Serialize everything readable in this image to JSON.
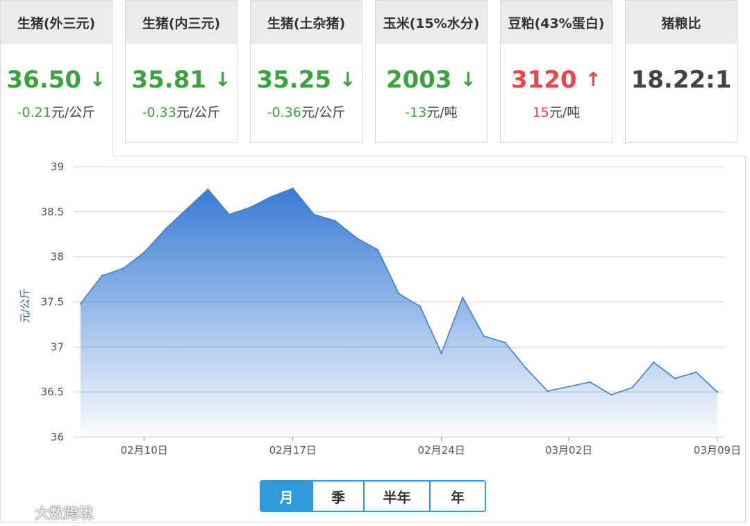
{
  "tabs": [
    {
      "title": "生猪(外三元)",
      "value": "36.50",
      "change": "-0.21",
      "unit": "元/公斤",
      "trend": "down",
      "arrow": "↓"
    },
    {
      "title": "生猪(内三元)",
      "value": "35.81",
      "change": "-0.33",
      "unit": "元/公斤",
      "trend": "down",
      "arrow": "↓"
    },
    {
      "title": "生猪(土杂猪)",
      "value": "35.25",
      "change": "-0.36",
      "unit": "元/公斤",
      "trend": "down",
      "arrow": "↓"
    },
    {
      "title": "玉米(15%水分)",
      "value": "2003",
      "change": "-13",
      "unit": "元/吨",
      "trend": "down",
      "arrow": "↓"
    },
    {
      "title": "豆粕(43%蛋白)",
      "value": "3120",
      "change": "15",
      "unit": "元/吨",
      "trend": "up",
      "arrow": "↑"
    },
    {
      "title": "猪粮比",
      "value": "18.22:1",
      "change": "",
      "unit": "",
      "trend": "neutral",
      "arrow": ""
    }
  ],
  "range_buttons": [
    "月",
    "季",
    "半年",
    "年"
  ],
  "active_range": "月",
  "watermark": "大数跨境",
  "colors": {
    "down": "#3aa340",
    "up": "#e9454d",
    "accent": "#2f9bde",
    "line": "#3f7ecb",
    "area_top": "#2e74d2"
  },
  "chart_data": {
    "type": "area",
    "title": "",
    "xlabel": "",
    "ylabel": "元/公斤",
    "ylim": [
      36,
      39
    ],
    "yticks": [
      "36",
      "36.5",
      "37",
      "37.5",
      "38",
      "38.5",
      "39"
    ],
    "xtick_labels": [
      "02月10日",
      "02月17日",
      "02月24日",
      "03月02日",
      "03月09日"
    ],
    "grid": true,
    "legend": "none",
    "series": [
      {
        "values": [
          {
            "x": "2023-02-07",
            "y": 37.48
          },
          {
            "x": "2023-02-08",
            "y": 37.79
          },
          {
            "x": "2023-02-09",
            "y": 37.87
          },
          {
            "x": "2023-02-10",
            "y": 38.05
          },
          {
            "x": "2023-02-11",
            "y": 38.31
          },
          {
            "x": "2023-02-12",
            "y": 38.53
          },
          {
            "x": "2023-02-13",
            "y": 38.75
          },
          {
            "x": "2023-02-14",
            "y": 38.47
          },
          {
            "x": "2023-02-15",
            "y": 38.55
          },
          {
            "x": "2023-02-16",
            "y": 38.67
          },
          {
            "x": "2023-02-17",
            "y": 38.76
          },
          {
            "x": "2023-02-18",
            "y": 38.47
          },
          {
            "x": "2023-02-19",
            "y": 38.4
          },
          {
            "x": "2023-02-20",
            "y": 38.21
          },
          {
            "x": "2023-02-21",
            "y": 38.08
          },
          {
            "x": "2023-02-22",
            "y": 37.59
          },
          {
            "x": "2023-02-23",
            "y": 37.45
          },
          {
            "x": "2023-02-24",
            "y": 36.93
          },
          {
            "x": "2023-02-25",
            "y": 37.55
          },
          {
            "x": "2023-02-26",
            "y": 37.12
          },
          {
            "x": "2023-02-27",
            "y": 37.05
          },
          {
            "x": "2023-02-28",
            "y": 36.76
          },
          {
            "x": "2023-03-01",
            "y": 36.51
          },
          {
            "x": "2023-03-02",
            "y": 36.56
          },
          {
            "x": "2023-03-03",
            "y": 36.61
          },
          {
            "x": "2023-03-04",
            "y": 36.47
          },
          {
            "x": "2023-03-05",
            "y": 36.55
          },
          {
            "x": "2023-03-06",
            "y": 36.83
          },
          {
            "x": "2023-03-07",
            "y": 36.65
          },
          {
            "x": "2023-03-08",
            "y": 36.72
          },
          {
            "x": "2023-03-09",
            "y": 36.5
          }
        ]
      }
    ]
  }
}
